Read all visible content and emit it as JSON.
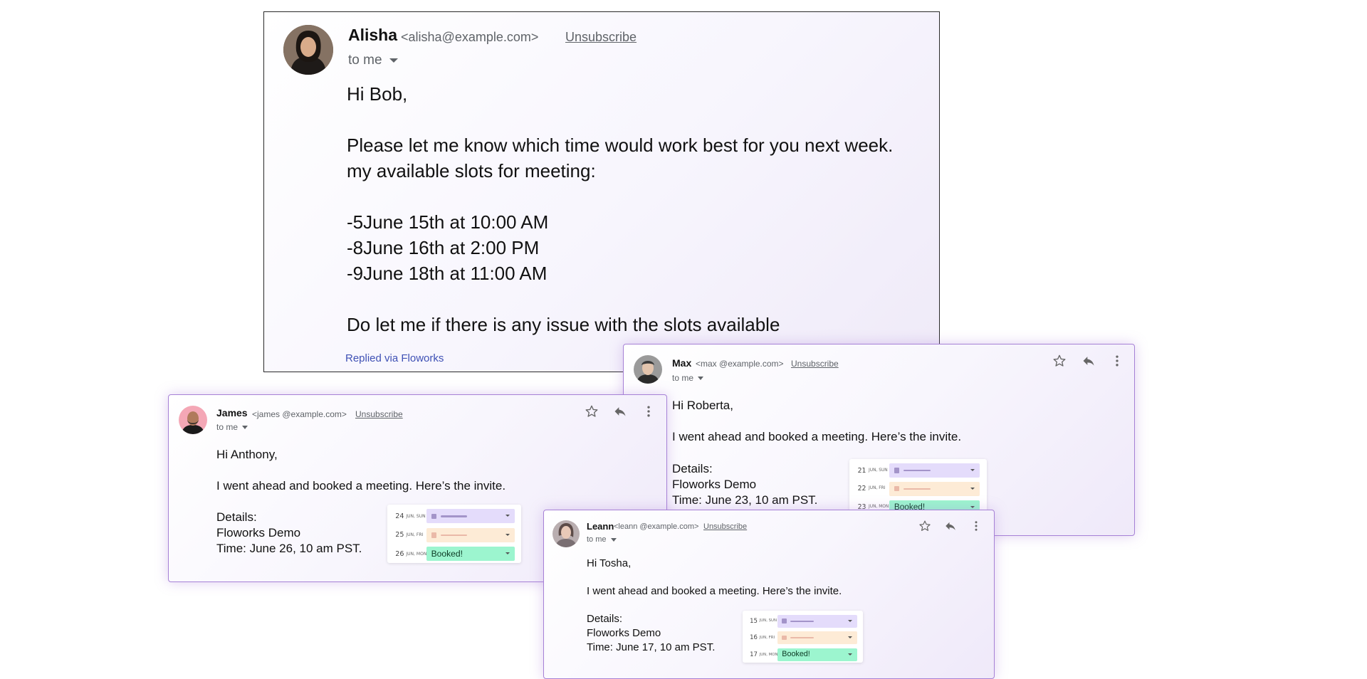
{
  "colors": {
    "accent_border": "#a681d6",
    "slot_purple": "#e4dcfb",
    "slot_peach": "#fdebd6",
    "slot_green": "#9cf5cf",
    "link": "#3f51b5",
    "muted": "#5f6368"
  },
  "icons": [
    "star-icon",
    "reply-icon",
    "more-vert-icon",
    "chevron-down-icon"
  ],
  "main_email": {
    "sender_name": "Alisha",
    "sender_email": "<alisha@example.com>",
    "unsubscribe": "Unsubscribe",
    "to": "to me",
    "greeting": "Hi Bob,",
    "body_line1": "Please let me know which time would work best for you next week.",
    "body_line2": "my available slots for meeting:",
    "slots": [
      "-5June 15th at 10:00 AM",
      "-8June 16th at 2:00 PM",
      "-9June 18th at 11:00 AM"
    ],
    "closing": "Do let me if there is any issue with the slots available",
    "replied_via": "Replied via Floworks"
  },
  "emails": [
    {
      "sender_name": "Max",
      "sender_email": "<max @example.com>",
      "unsubscribe": "Unsubscribe",
      "to": "to me",
      "greeting": "Hi Roberta,",
      "body": "I went ahead and booked a meeting. Here’s the invite.",
      "details_label": "Details:",
      "event": "Floworks Demo",
      "time": "Time: June 23, 10 am PST.",
      "mini": {
        "rows": [
          {
            "date": "21",
            "day": "JUN, SUN",
            "status": "purple",
            "label": ""
          },
          {
            "date": "22",
            "day": "JUN, FRI",
            "status": "peach",
            "label": ""
          },
          {
            "date": "23",
            "day": "JUN, MON",
            "status": "green",
            "label": "Booked!"
          }
        ]
      }
    },
    {
      "sender_name": "James",
      "sender_email": "<james @example.com>",
      "unsubscribe": "Unsubscribe",
      "to": "to me",
      "greeting": "Hi Anthony,",
      "body": "I went ahead and booked a meeting. Here’s the invite.",
      "details_label": "Details:",
      "event": "Floworks Demo",
      "time": "Time: June 26, 10 am PST.",
      "mini": {
        "rows": [
          {
            "date": "24",
            "day": "JUN, SUN",
            "status": "purple",
            "label": ""
          },
          {
            "date": "25",
            "day": "JUN, FRI",
            "status": "peach",
            "label": ""
          },
          {
            "date": "26",
            "day": "JUN, MON",
            "status": "green",
            "label": "Booked!"
          }
        ]
      }
    },
    {
      "sender_name": "Leann",
      "sender_email": "<leann @example.com>",
      "unsubscribe": "Unsubscribe",
      "to": "to me",
      "greeting": "Hi Tosha,",
      "body": "I went ahead and booked a meeting. Here’s the invite.",
      "details_label": "Details:",
      "event": "Floworks Demo",
      "time": "Time: June 17, 10 am PST.",
      "mini": {
        "rows": [
          {
            "date": "15",
            "day": "JUN, SUN",
            "status": "purple",
            "label": ""
          },
          {
            "date": "16",
            "day": "JUN, FRI",
            "status": "peach",
            "label": ""
          },
          {
            "date": "17",
            "day": "JUN, MON",
            "status": "green",
            "label": "Booked!"
          }
        ]
      }
    }
  ]
}
